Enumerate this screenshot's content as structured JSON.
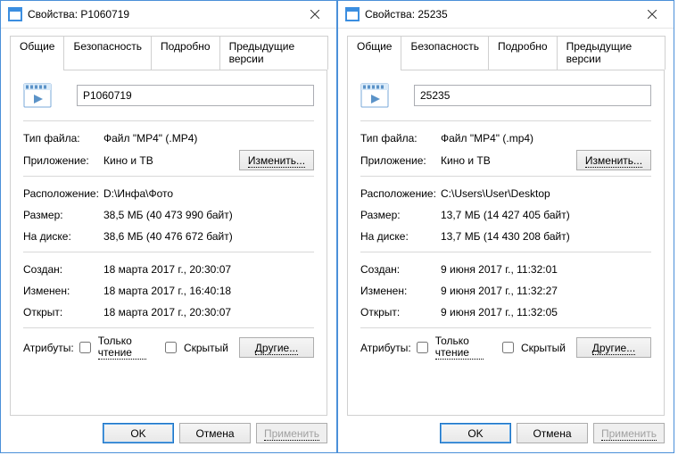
{
  "dialogs": [
    {
      "title": "Свойства: P1060719",
      "filename": "P1060719",
      "filetype": "Файл \"MP4\" (.MP4)",
      "app": "Кино и ТВ",
      "location": "D:\\Инфа\\Фото",
      "size": "38,5 МБ (40 473 990 байт)",
      "size_on_disk": "38,6 МБ (40 476 672 байт)",
      "created": "18 марта 2017 г., 20:30:07",
      "modified": "18 марта 2017 г., 16:40:18",
      "accessed": "18 марта 2017 г., 20:30:07"
    },
    {
      "title": "Свойства: 25235",
      "filename": "25235",
      "filetype": "Файл \"MP4\" (.mp4)",
      "app": "Кино и ТВ",
      "location": "C:\\Users\\User\\Desktop",
      "size": "13,7 МБ (14 427 405 байт)",
      "size_on_disk": "13,7 МБ (14 430 208 байт)",
      "created": "9 июня 2017 г., 11:32:01",
      "modified": "9 июня 2017 г., 11:32:27",
      "accessed": "9 июня 2017 г., 11:32:05"
    }
  ],
  "tabs": {
    "general": "Общие",
    "security": "Безопасность",
    "details": "Подробно",
    "previous": "Предыдущие версии"
  },
  "labels": {
    "filetype": "Тип файла:",
    "app": "Приложение:",
    "change": "Изменить...",
    "location": "Расположение:",
    "size": "Размер:",
    "size_on_disk": "На диске:",
    "created": "Создан:",
    "modified": "Изменен:",
    "accessed": "Открыт:",
    "attributes": "Атрибуты:",
    "readonly": "Только чтение",
    "hidden": "Скрытый",
    "other": "Другие...",
    "ok": "OK",
    "cancel": "Отмена",
    "apply": "Применить"
  }
}
